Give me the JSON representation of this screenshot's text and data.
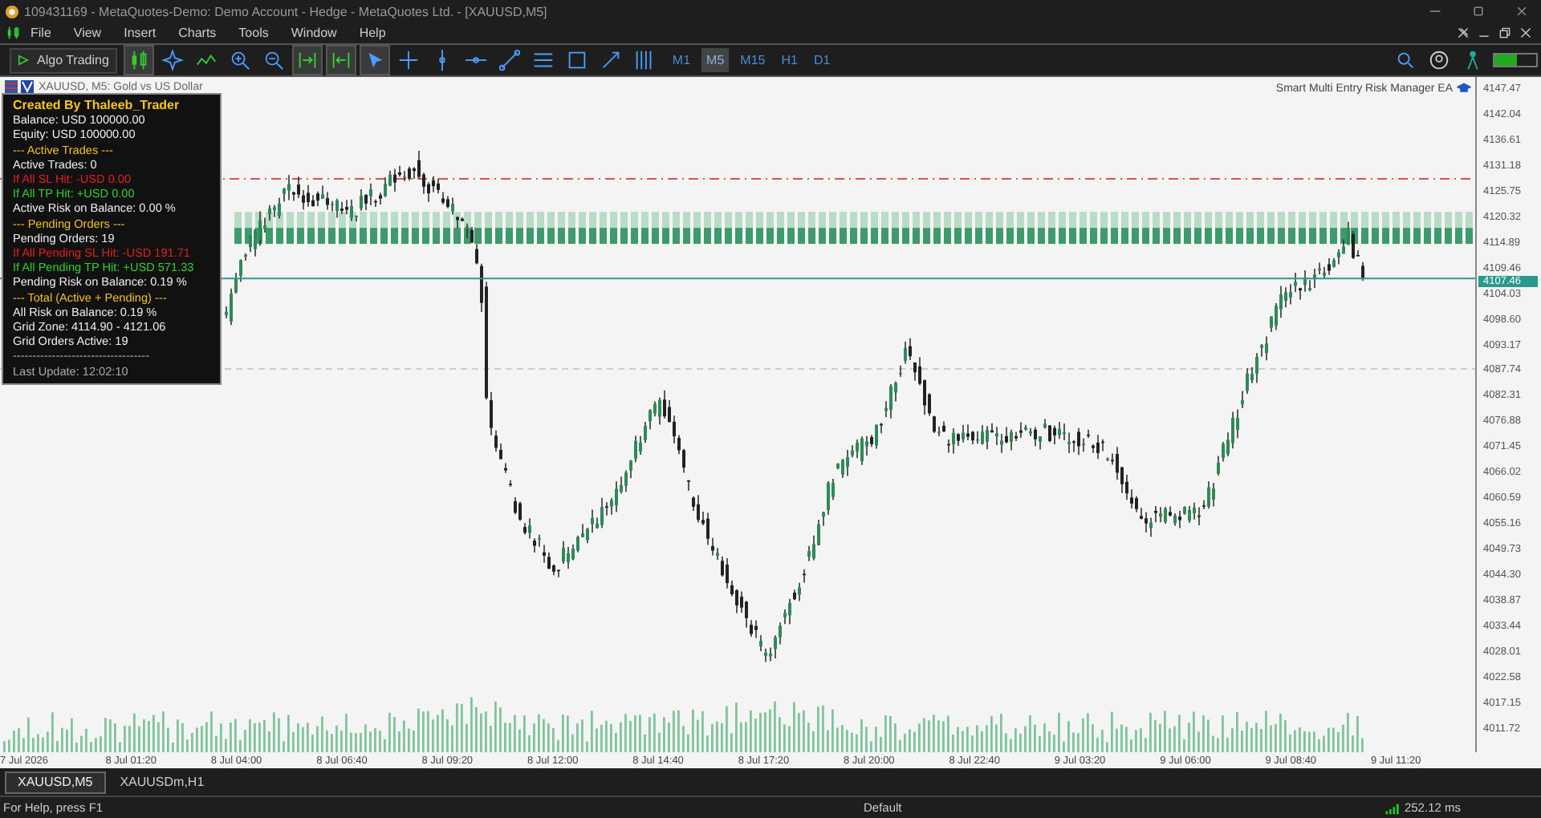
{
  "window": {
    "title": "109431169 - MetaQuotes-Demo: Demo Account - Hedge - MetaQuotes Ltd. - [XAUUSD,M5]"
  },
  "menu": [
    "File",
    "View",
    "Insert",
    "Charts",
    "Tools",
    "Window",
    "Help"
  ],
  "toolbar": {
    "algo_button": "Algo Trading",
    "timeframes": [
      {
        "label": "M1",
        "selected": false
      },
      {
        "label": "M5",
        "selected": true
      },
      {
        "label": "M15",
        "selected": false
      },
      {
        "label": "H1",
        "selected": false
      },
      {
        "label": "D1",
        "selected": false
      }
    ]
  },
  "chart": {
    "symbol_label": "XAUUSD, M5:  Gold vs US Dollar",
    "ea_label": "Smart Multi Entry Risk Manager EA",
    "current_price": "4107.46",
    "price_ticks": [
      "4147.47",
      "4142.04",
      "4136.61",
      "4131.18",
      "4125.75",
      "4120.32",
      "4114.89",
      "4109.46",
      "4104.03",
      "4098.60",
      "4093.17",
      "4087.74",
      "4082.31",
      "4076.88",
      "4071.45",
      "4066.02",
      "4060.59",
      "4055.16",
      "4049.73",
      "4044.30",
      "4038.87",
      "4033.44",
      "4028.01",
      "4022.58",
      "4017.15",
      "4011.72"
    ],
    "time_ticks": [
      "7 Jul 2026",
      "8 Jul 01:20",
      "8 Jul 04:00",
      "8 Jul 06:40",
      "8 Jul 09:20",
      "8 Jul 12:00",
      "8 Jul 14:40",
      "8 Jul 17:20",
      "8 Jul 20:00",
      "8 Jul 22:40",
      "9 Jul 03:20",
      "9 Jul 06:00",
      "9 Jul 08:40",
      "9 Jul 11:20"
    ],
    "panel": {
      "lines": [
        {
          "text": "Created By Thaleeb_Trader",
          "kind": "title"
        },
        {
          "text": "Balance: USD 100000.00",
          "kind": "normal"
        },
        {
          "text": "Equity: USD 100000.00",
          "kind": "normal"
        },
        {
          "text": "--- Active Trades ---",
          "kind": "header"
        },
        {
          "text": "Active Trades: 0",
          "kind": "normal"
        },
        {
          "text": "If All SL Hit: -USD 0.00",
          "kind": "loss"
        },
        {
          "text": "If All TP Hit: +USD 0.00",
          "kind": "profit"
        },
        {
          "text": "Active Risk on Balance: 0.00 %",
          "kind": "normal"
        },
        {
          "text": "--- Pending Orders ---",
          "kind": "header"
        },
        {
          "text": "Pending Orders: 19",
          "kind": "normal"
        },
        {
          "text": "If All Pending SL Hit: -USD 191.71",
          "kind": "loss"
        },
        {
          "text": "If All Pending TP Hit: +USD 571.33",
          "kind": "profit"
        },
        {
          "text": "Pending Risk on Balance: 0.19 %",
          "kind": "normal"
        },
        {
          "text": "--- Total (Active + Pending) ---",
          "kind": "header"
        },
        {
          "text": "All Risk on Balance: 0.19 %",
          "kind": "normal"
        },
        {
          "text": "Grid Zone: 4114.90 - 4121.06",
          "kind": "normal"
        },
        {
          "text": "Grid Orders Active: 19",
          "kind": "normal"
        },
        {
          "text": "-----------------------------------",
          "kind": "muted"
        },
        {
          "text": "Last Update: 12:02:10",
          "kind": "muted"
        }
      ]
    }
  },
  "tabs": [
    {
      "label": "XAUUSD,M5",
      "selected": true
    },
    {
      "label": "XAUUSDm,H1",
      "selected": false
    }
  ],
  "status_bar": {
    "help": "For Help, press F1",
    "profile": "Default",
    "ping": "252.12 ms"
  }
}
